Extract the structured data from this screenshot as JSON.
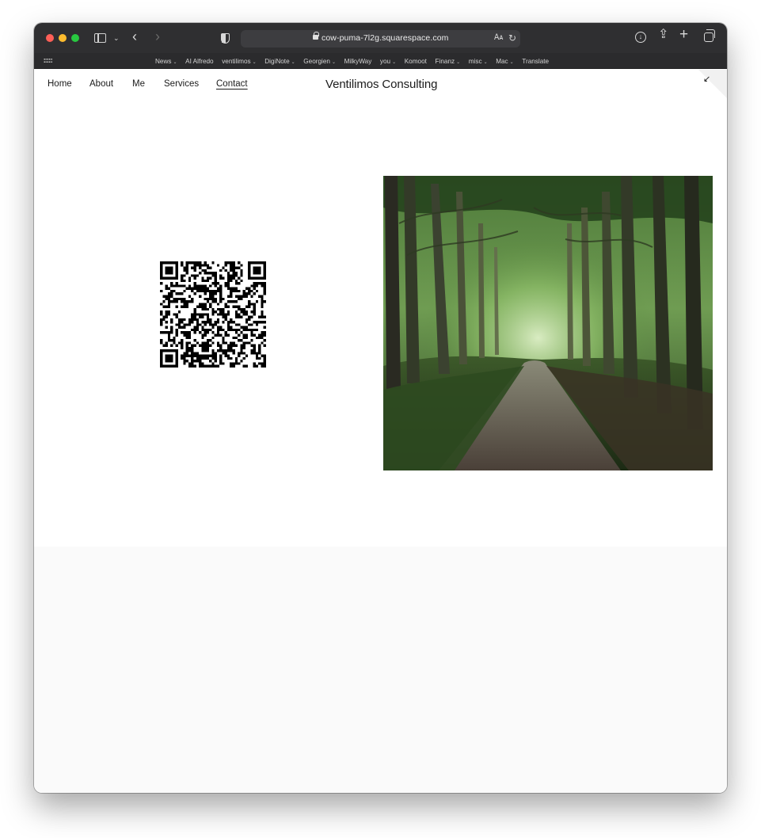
{
  "browser": {
    "url": "cow-puma-7l2g.squarespace.com",
    "icons": [
      "sidebar-icon",
      "chevron-down-icon",
      "back-icon",
      "forward-icon",
      "shield-icon",
      "lock-icon",
      "translate-icon",
      "reload-icon",
      "download-icon",
      "share-icon",
      "new-tab-icon",
      "tab-overview-icon"
    ],
    "favorites": [
      {
        "label": "News",
        "menu": true
      },
      {
        "label": "AI Alfredo",
        "menu": false
      },
      {
        "label": "ventilimos",
        "menu": true
      },
      {
        "label": "DigiNote",
        "menu": true
      },
      {
        "label": "Georgien",
        "menu": true
      },
      {
        "label": "MilkyWay",
        "menu": false
      },
      {
        "label": "you",
        "menu": true
      },
      {
        "label": "Komoot",
        "menu": false
      },
      {
        "label": "Finanz",
        "menu": true
      },
      {
        "label": "misc",
        "menu": true
      },
      {
        "label": "Mac",
        "menu": true
      },
      {
        "label": "Translate",
        "menu": false
      }
    ]
  },
  "site": {
    "title": "Ventilimos Consulting",
    "nav": [
      "Home",
      "About",
      "Me",
      "Services",
      "Contact"
    ],
    "active_nav": "Contact"
  },
  "colors": {
    "toolbar": "#2f2f31",
    "page_bg": "#ffffff",
    "footer_bg": "#fafafa"
  }
}
